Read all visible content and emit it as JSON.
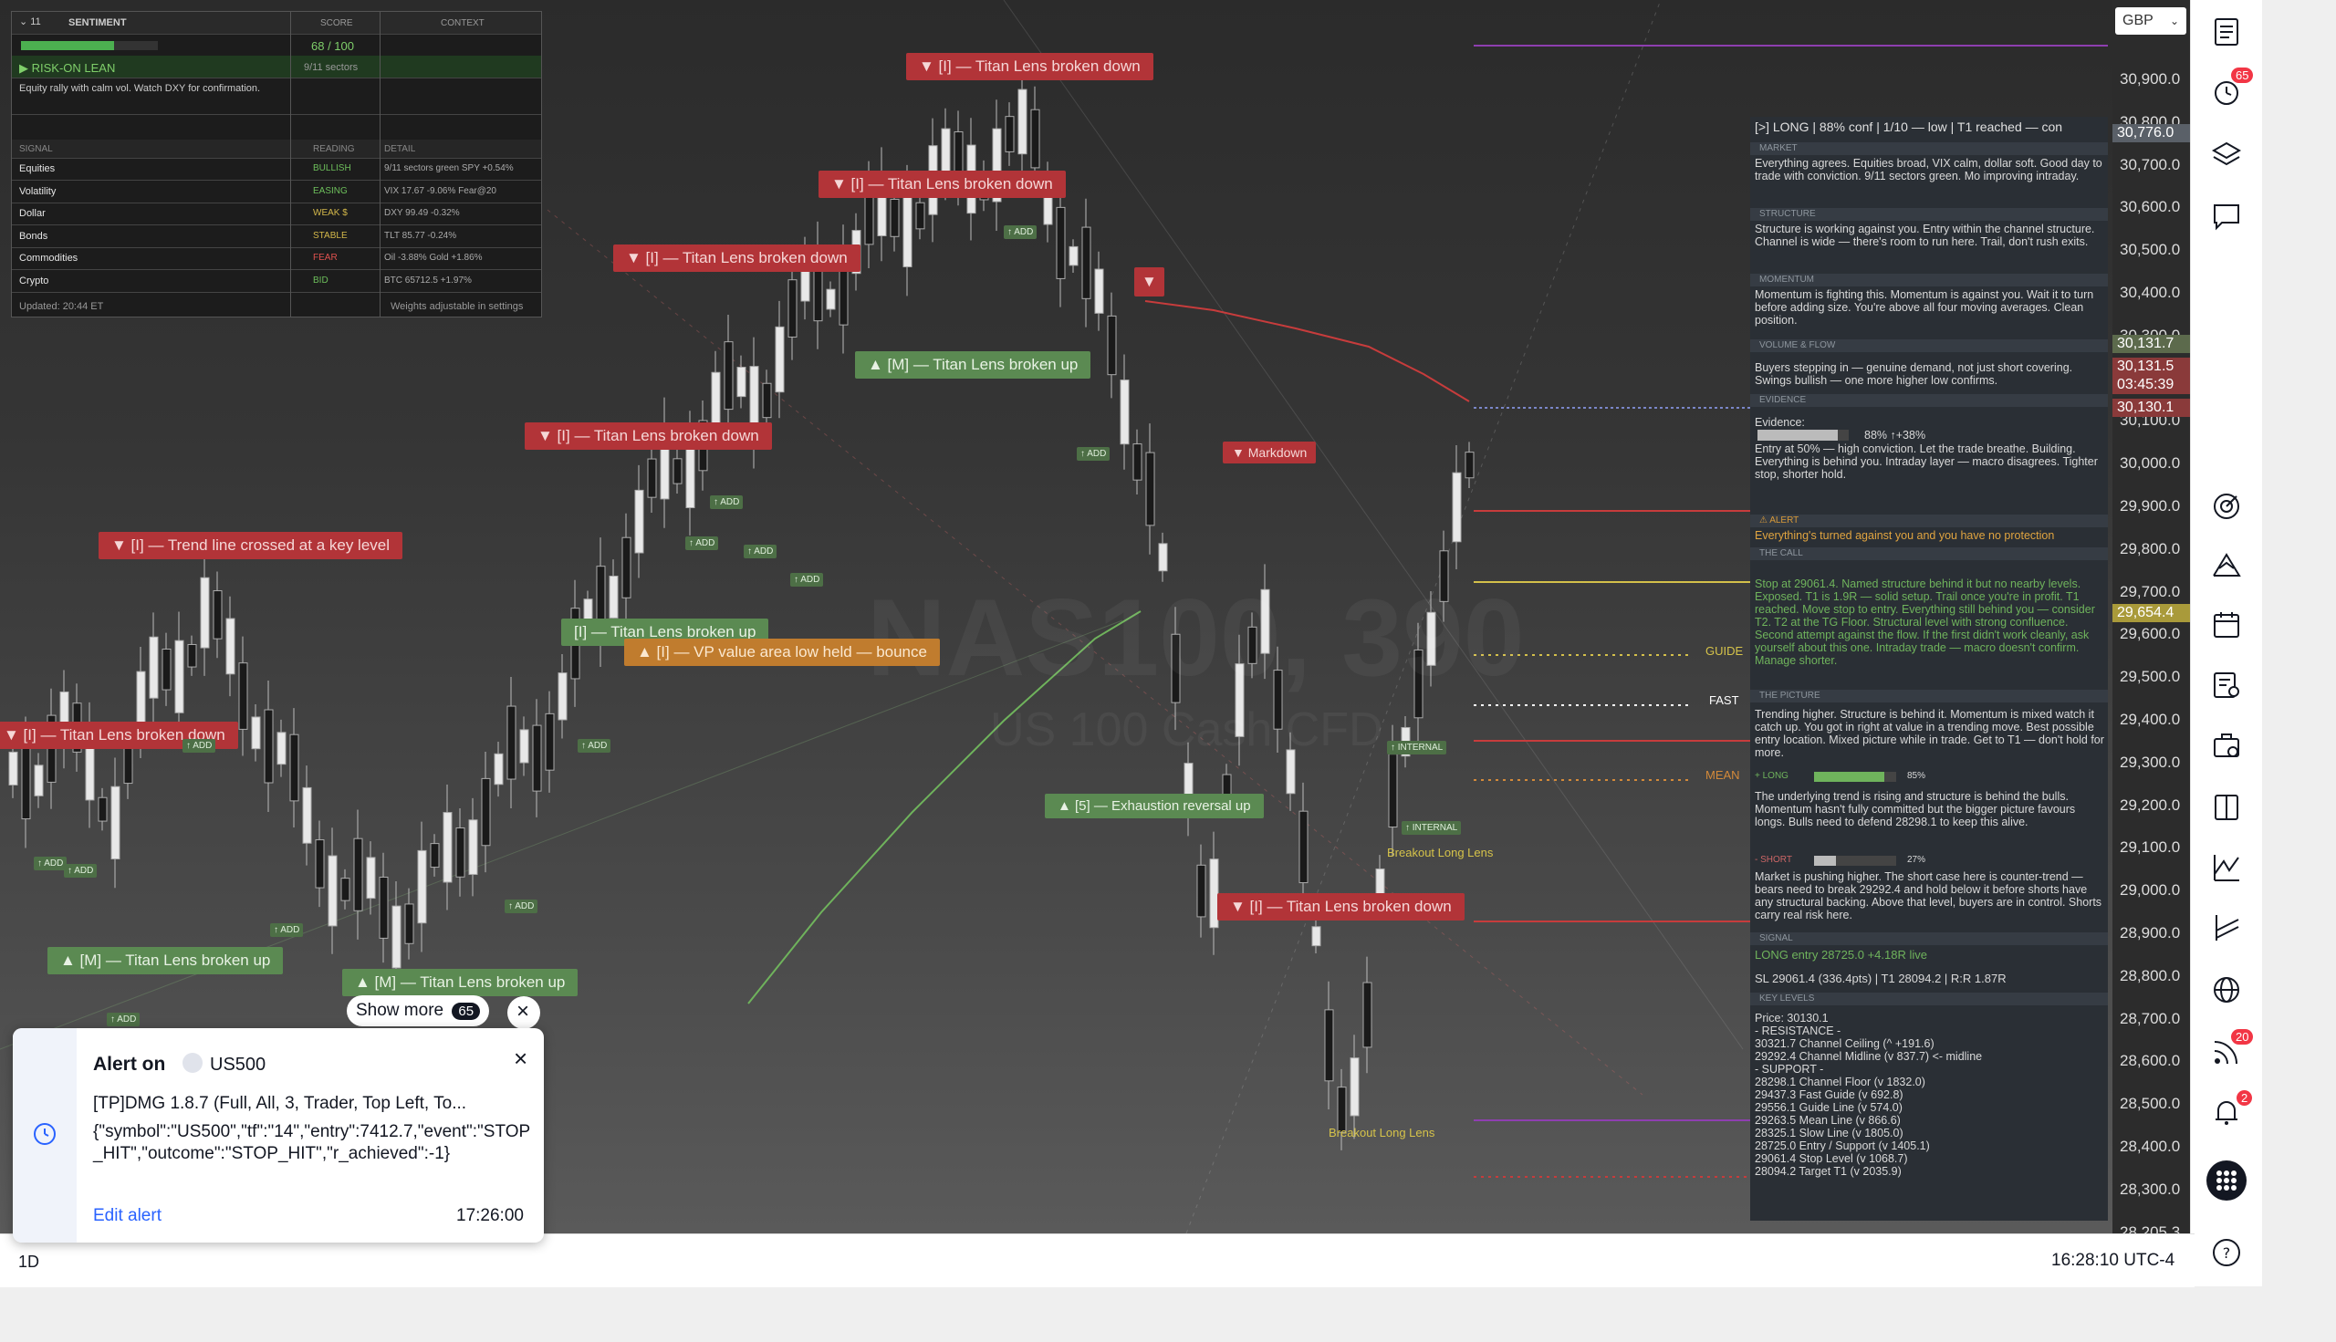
{
  "sentiment": {
    "collapse_label": "11",
    "title": "SENTIMENT",
    "col_score": "SCORE",
    "col_context": "CONTEXT",
    "score": "68 / 100",
    "score_fraction": 0.68,
    "regime": "▶ RISK-ON LEAN",
    "sectors": "9/11 sectors",
    "summary": "Equity rally with calm vol. Watch DXY for confirmation.",
    "col_signal": "SIGNAL",
    "col_reading": "READING",
    "col_detail": "DETAIL",
    "rows": [
      {
        "signal": "Equities",
        "reading": "BULLISH",
        "detail": "9/11 sectors green  SPY +0.54%",
        "color": "#6dbf5b"
      },
      {
        "signal": "Volatility",
        "reading": "EASING",
        "detail": "VIX 17.67  -9.06%  Fear@20",
        "color": "#6dbf5b"
      },
      {
        "signal": "Dollar",
        "reading": "WEAK $",
        "detail": "DXY 99.49  -0.32%",
        "color": "#d4b84a"
      },
      {
        "signal": "Bonds",
        "reading": "STABLE",
        "detail": "TLT 85.77  -0.24%",
        "color": "#d4b84a"
      },
      {
        "signal": "Commodities",
        "reading": "FEAR",
        "detail": "Oil -3.88%  Gold +1.86%",
        "color": "#e0524f"
      },
      {
        "signal": "Crypto",
        "reading": "BID",
        "detail": "BTC 65712.5  +1.97%",
        "color": "#6dbf5b"
      }
    ],
    "updated": "Updated: 20:44 ET",
    "footer_note": "Weights adjustable in settings"
  },
  "chart": {
    "watermark": "NAS100, 390",
    "watermark_sub": "US 100 Cash CFD",
    "labels": {
      "titan_broken_down": "▼ [I] — Titan Lens broken down",
      "titan_broken_up_m": "▲ [M] — Titan Lens broken up",
      "titan_broken_up_i": "[I] — Titan Lens broken up",
      "trend_line": "▼ [I] — Trend line crossed at a key level",
      "vp_value": "▲ [I] — VP value area low held — bounce",
      "markdown": "▼ Markdown",
      "exhaustion": "▲ [5] — Exhaustion reversal up",
      "arrow_down": "▼",
      "add": "↑ ADD",
      "breakout_long": "Breakout Long Lens",
      "internal": "↑ INTERNAL",
      "guide": "GUIDE",
      "fast": "FAST",
      "mean": "MEAN"
    }
  },
  "price_axis": {
    "currency": "GBP",
    "ticks": [
      "30,900.0",
      "30,800.0",
      "30,700.0",
      "30,600.0",
      "30,500.0",
      "30,400.0",
      "30,300.0",
      "30,200.0",
      "30,100.0",
      "30,000.0",
      "29,900.0",
      "29,800.0",
      "29,700.0",
      "29,600.0",
      "29,500.0",
      "29,400.0",
      "29,300.0",
      "29,200.0",
      "29,100.0",
      "29,000.0",
      "28,900.0",
      "28,800.0",
      "28,700.0",
      "28,600.0",
      "28,500.0",
      "28,400.0",
      "28,300.0",
      "28,205.3"
    ],
    "tags": [
      {
        "text": "30,776.0",
        "bg": "#5a6068",
        "fg": "#ffffff"
      },
      {
        "text": "30,131.7",
        "bg": "#5c6a4c",
        "fg": "#ffffff"
      },
      {
        "text": "30,131.5",
        "bg": "#8a3a3a",
        "fg": "#ffffff"
      },
      {
        "text": "03:45:39",
        "bg": "#8a3a3a",
        "fg": "#ffffff"
      },
      {
        "text": "30,130.1",
        "bg": "#8a3a3a",
        "fg": "#ffffff"
      },
      {
        "text": "29,654.4",
        "bg": "#a99a3a",
        "fg": "#ffffff"
      }
    ]
  },
  "analysis": {
    "header": "[>]  LONG  |  88% conf  |  1/10 — low  |  T1 reached — con",
    "market_title": "MARKET",
    "market_text": "Everything agrees. Equities broad, VIX calm, dollar soft. Good day to trade with conviction. 9/11 sectors green. Mo improving intraday.",
    "structure_title": "STRUCTURE",
    "structure_text": "Structure is working against you. Entry within the channel structure. Channel is wide — there's room to run here. Trail, don't rush exits.",
    "momentum_title": "MOMENTUM",
    "momentum_text": "Momentum is fighting this. Momentum is against you. Wait it to turn before adding size. You're above all four moving averages. Clean position.",
    "volume_title": "VOLUME & FLOW",
    "volume_text": "Buyers stepping in — genuine demand, not just short covering. Swings bullish — one more higher low confirms.",
    "evidence_title": "EVIDENCE",
    "evidence_label": "Evidence:",
    "evidence_value": "88% ↑+38%",
    "evidence_fraction": 0.88,
    "evidence_text": "Entry at 50% — high conviction. Let the trade breathe.  Building. Everything is behind you. Intraday layer — macro disagrees. Tighter stop, shorter hold.",
    "alert_title": "⚠ ALERT",
    "alert_text": "Everything's turned against you and you have no protection",
    "call_title": "THE CALL",
    "call_text": "Stop at 29061.4. Named structure behind it but no nearby levels. Exposed. T1 is 1.9R — solid setup. Trail once you're in profit. T1 reached. Move stop to entry. Everything still behind you — consider T2. T2 at the TG Floor. Structural level with strong confluence. Second attempt against the flow. If the first didn't work cleanly, ask yourself about this one. Intraday trade — macro doesn't confirm. Manage shorter.",
    "picture_title": "THE PICTURE",
    "picture_text": "Trending higher. Structure is behind it. Momentum is mixed watch it catch up. You got in right at value in a trending move. Best possible entry location. Mixed picture while in trade. Get to T1 — don't hold for more.",
    "long_label": "+ LONG",
    "long_value": "85%",
    "long_fraction": 0.85,
    "long_text": "The underlying trend is rising and structure is behind the bulls. Momentum hasn't fully committed but the bigger picture favours longs. Bulls need to defend 28298.1 to keep this alive.",
    "short_label": "- SHORT",
    "short_value": "27%",
    "short_fraction": 0.27,
    "short_text": "Market is pushing higher. The short case here is counter-trend — bears need to break 29292.4 and hold below it before shorts have any structural backing. Above that level, buyers are in control. Shorts carry real risk here.",
    "signal_title": "SIGNAL",
    "signal_line1": "LONG  entry 28725.0  +4.18R live",
    "signal_line2": "SL 29061.4  (336.4pts)  |  T1 28094.2  |  R:R 1.87R",
    "keylevels_title": "KEY LEVELS",
    "price": "Price: 30130.1",
    "resistance_title": "-  RESISTANCE  -",
    "resistance": [
      "30321.7  Channel Ceiling  (^ +191.6)",
      "29292.4  Channel Midline  (v 837.7)  <- midline"
    ],
    "support_title": "-  SUPPORT  -",
    "support": [
      "28298.1  Channel Floor  (v 1832.0)",
      "29437.3  Fast Guide  (v 692.8)",
      "29556.1  Guide Line  (v 574.0)",
      "29263.5  Mean Line  (v 866.6)",
      "28325.1  Slow Line  (v 1805.0)",
      "28725.0  Entry / Support  (v 1405.1)",
      "29061.4  Stop Level  (v 1068.7)",
      "28094.2  Target T1  (v 2035.9)"
    ]
  },
  "sidebar": {
    "badge_alerts": "65",
    "badge_feed": "20",
    "badge_notifications": "2"
  },
  "bottom": {
    "interval": "1D",
    "clock": "16:28:10 UTC-4"
  },
  "alert": {
    "title": "Alert on",
    "symbol": "US500",
    "name": "[TP]DMG 1.8.7 (Full, All, 3, Trader, Top Left, To...",
    "body": "{\"symbol\":\"US500\",\"tf\":\"14\",\"entry\":7412.7,\"event\":\"STOP_HIT\",\"outcome\":\"STOP_HIT\",\"r_achieved\":-1}",
    "edit": "Edit alert",
    "time": "17:26:00",
    "show_more": "Show more",
    "show_more_count": "65"
  }
}
